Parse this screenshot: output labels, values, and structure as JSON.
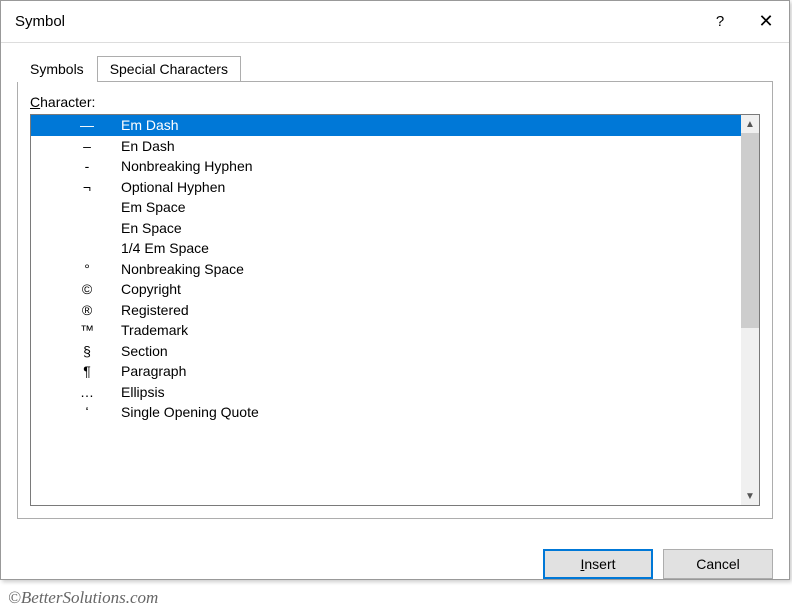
{
  "window": {
    "title": "Symbol",
    "help_glyph": "?",
    "close_glyph": "✕"
  },
  "tabs": {
    "symbols": "Symbols",
    "special": "Special Characters"
  },
  "label": {
    "character_prefix": "C",
    "character_rest": "haracter:"
  },
  "rows": [
    {
      "symbol": "—",
      "name": "Em Dash",
      "selected": true
    },
    {
      "symbol": "–",
      "name": "En Dash",
      "selected": false
    },
    {
      "symbol": "-",
      "name": "Nonbreaking Hyphen",
      "selected": false
    },
    {
      "symbol": "¬",
      "name": "Optional Hyphen",
      "selected": false
    },
    {
      "symbol": "",
      "name": "Em Space",
      "selected": false
    },
    {
      "symbol": "",
      "name": "En Space",
      "selected": false
    },
    {
      "symbol": "",
      "name": "1/4 Em Space",
      "selected": false
    },
    {
      "symbol": "°",
      "name": "Nonbreaking Space",
      "selected": false
    },
    {
      "symbol": "©",
      "name": "Copyright",
      "selected": false
    },
    {
      "symbol": "®",
      "name": "Registered",
      "selected": false
    },
    {
      "symbol": "™",
      "name": "Trademark",
      "selected": false
    },
    {
      "symbol": "§",
      "name": "Section",
      "selected": false
    },
    {
      "symbol": "¶",
      "name": "Paragraph",
      "selected": false
    },
    {
      "symbol": "…",
      "name": "Ellipsis",
      "selected": false
    },
    {
      "symbol": "ʻ",
      "name": "Single Opening Quote",
      "selected": false
    }
  ],
  "scroll": {
    "up_glyph": "▲",
    "down_glyph": "▼"
  },
  "buttons": {
    "insert_prefix": "I",
    "insert_rest": "nsert",
    "cancel": "Cancel"
  },
  "watermark": "©BetterSolutions.com"
}
